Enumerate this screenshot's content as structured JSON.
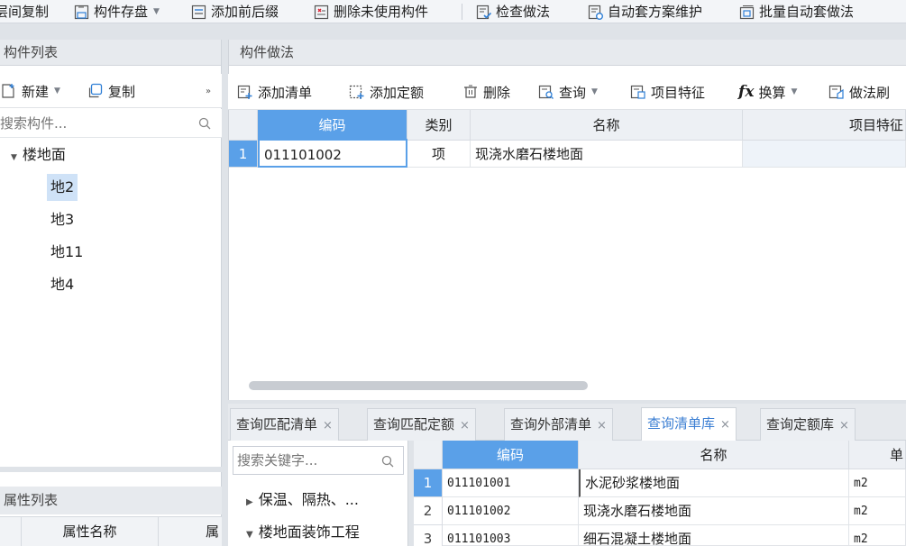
{
  "toolbar": {
    "items": [
      {
        "label": "层间复制"
      },
      {
        "label": "构件存盘"
      },
      {
        "label": "添加前后缀"
      },
      {
        "label": "删除未使用构件"
      },
      {
        "label": "检查做法"
      },
      {
        "label": "自动套方案维护"
      },
      {
        "label": "批量自动套做法"
      }
    ]
  },
  "left_panel": {
    "title": "构件列表",
    "new_label": "新建",
    "copy_label": "复制",
    "search_placeholder": "搜索构件...",
    "tree": {
      "root": "楼地面",
      "children": [
        "地2",
        "地3",
        "地11",
        "地4"
      ],
      "selected": "地2"
    }
  },
  "props_panel": {
    "title": "属性列表",
    "col_name": "属性名称",
    "col_value": "属"
  },
  "method_panel": {
    "title": "构件做法",
    "toolbar": [
      "添加清单",
      "添加定额",
      "删除",
      "查询",
      "项目特征",
      "换算",
      "做法刷"
    ],
    "columns": [
      "编码",
      "类别",
      "名称",
      "项目特征"
    ],
    "rows": [
      {
        "num": "1",
        "code": "011101002",
        "type": "项",
        "name": "现浇水磨石楼地面",
        "feature": ""
      }
    ]
  },
  "bottom_tabs": {
    "tabs": [
      "查询匹配清单",
      "查询匹配定额",
      "查询外部清单",
      "查询清单库",
      "查询定额库"
    ],
    "active": "查询清单库"
  },
  "bottom_left": {
    "search_placeholder": "搜索关键字...",
    "tree": [
      "保温、隔热、...",
      "楼地面装饰工程"
    ]
  },
  "bottom_grid": {
    "columns": [
      "编码",
      "名称",
      "单"
    ],
    "rows": [
      {
        "num": "1",
        "code": "011101001",
        "name": "水泥砂浆楼地面",
        "unit": "m2"
      },
      {
        "num": "2",
        "code": "011101002",
        "name": "现浇水磨石楼地面",
        "unit": "m2"
      },
      {
        "num": "3",
        "code": "011101003",
        "name": "细石混凝土楼地面",
        "unit": "m2"
      }
    ]
  },
  "colors": {
    "accent": "#5aa0e8",
    "selected": "#cfe2f7",
    "active_tab_text": "#3c7fd3"
  }
}
